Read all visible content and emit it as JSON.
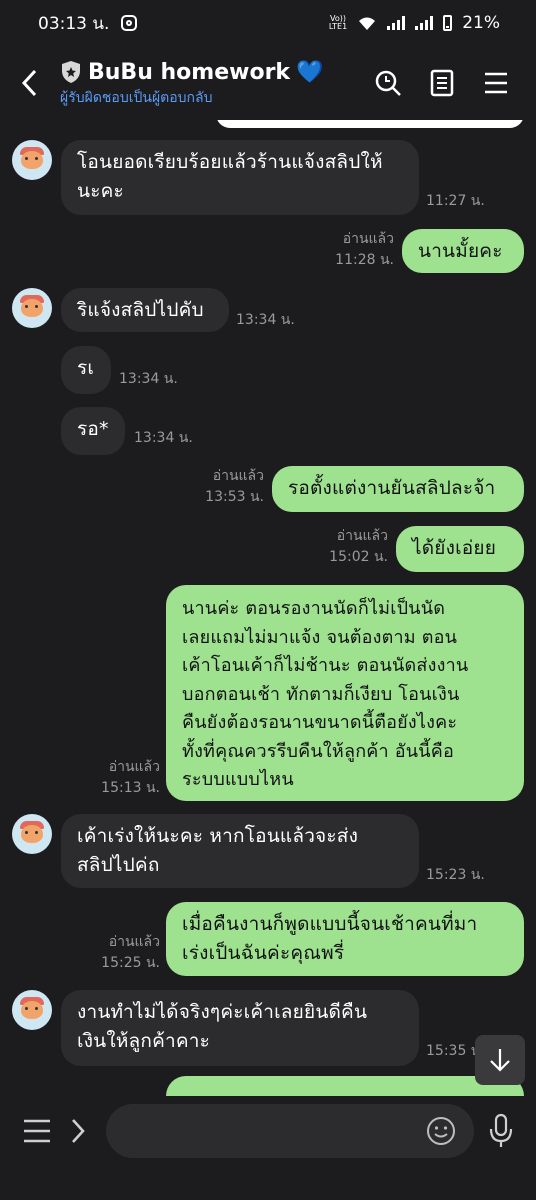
{
  "status": {
    "time": "03:13 น.",
    "volte": "Vo)) LTE1",
    "battery": "21%"
  },
  "header": {
    "title": "BuBu homework",
    "heart": "💙",
    "subtitle": "ผู้รับผิดชอบเป็นผู้ตอบกลับ"
  },
  "messages": [
    {
      "text": "โอนยอดเรียบร้อยแล้วร้านแจ้งสลิปให้\nนะคะ",
      "time": "11:27 น."
    },
    {
      "read": "อ่านแล้ว",
      "text": "นานมั้ยคะ",
      "time": "11:28 น."
    },
    {
      "text": "ริแจ้งสลิปไปคับ",
      "time": "13:34 น."
    },
    {
      "text": "รเ",
      "time": "13:34 น."
    },
    {
      "text": "รอ*",
      "time": "13:34 น."
    },
    {
      "read": "อ่านแล้ว",
      "text": "รอตั้งแต่งานยันสลิปละจ้า",
      "time": "13:53 น."
    },
    {
      "read": "อ่านแล้ว",
      "text": "ได้ยังเอ่ยย",
      "time": "15:02 น."
    },
    {
      "read": "อ่านแล้ว",
      "text": "นานค่ะ ตอนรองานนัดก็ไม่เป็นนัด\nเลยแถมไม่มาแจ้ง จนต้องตาม ตอน\nเค้าโอนเค้าก็ไม่ช้านะ ตอนนัดส่งงาน\nบอกตอนเช้า ทักตามก็เงียบ โอนเงิน\nคืนยังต้องรอนานขนาดนี้ตือยังไงคะ\nทั้งที่คุณควรรีบคืนให้ลูกค้า อันนี้คือ\nระบบแบบไหน",
      "time": "15:13 น."
    },
    {
      "text": "เค้าเร่งให้นะคะ หากโอนแล้วจะส่ง\nสลิปไปค่ถ",
      "time": "15:23 น."
    },
    {
      "read": "อ่านแล้ว",
      "text": "เมื่อคืนงานก็พูดแบบนี้จนเช้าคนที่มา\nเร่งเป็นฉันค่ะคุณพรี่",
      "time": "15:25 น."
    },
    {
      "text": "งานทำไม่ได้จริงๆค่ะเค้าเลยยินดีคืน\nเงินให้ลูกค้าคาะ",
      "time": "15:35 น."
    }
  ],
  "icons": {
    "back": "back-arrow-icon",
    "search": "search-icon",
    "notes": "notes-icon",
    "menu": "menu-icon",
    "scroll": "arrow-down-icon",
    "emoji": "emoji-icon",
    "mic": "mic-icon"
  },
  "colors": {
    "background": "#1c1c1e",
    "incoming": "#2c2c2e",
    "outgoing": "#9ee28f",
    "subtitle": "#5a9bf6"
  }
}
